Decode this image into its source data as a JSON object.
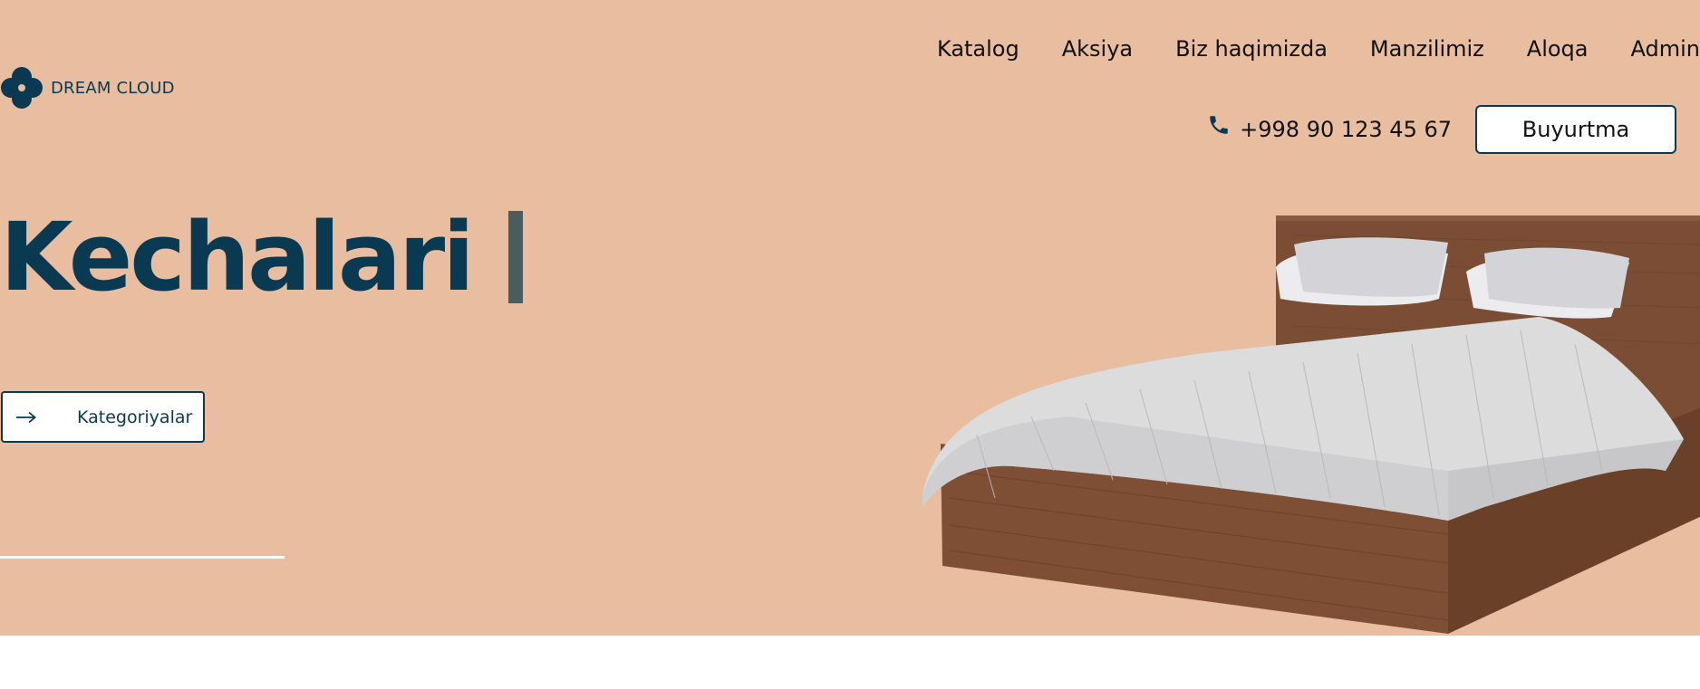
{
  "brand": {
    "name": "DREAM CLOUD",
    "logo_icon": "four-circle-clover-logo"
  },
  "nav": {
    "items": [
      "Katalog",
      "Aksiya",
      "Biz haqimizda",
      "Manzilimiz",
      "Aloqa",
      "Admin"
    ]
  },
  "contact": {
    "phone_icon": "phone-icon",
    "phone": "+998 90 123 45 67",
    "order_label": "Buyurtma"
  },
  "hero": {
    "headline": "Kechalari",
    "category_button_label": "Kategoriyalar",
    "category_button_icon": "arrow-right-icon",
    "image": "wooden-double-bed-with-striped-bedding"
  },
  "colors": {
    "hero_background": "#e8bda0",
    "brand_navy": "#0a3a52",
    "cursor_bar": "#4b5c5e",
    "page_background": "#ffffff"
  }
}
